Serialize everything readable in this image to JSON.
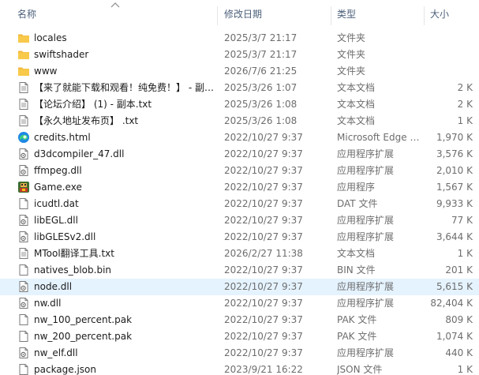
{
  "header": {
    "name": "名称",
    "date": "修改日期",
    "type": "类型",
    "size": "大小"
  },
  "rows": [
    {
      "name": "locales",
      "date": "2025/3/7 21:17",
      "type": "文件夹",
      "size": "",
      "icon": "folder-icon"
    },
    {
      "name": "swiftshader",
      "date": "2025/3/7 21:17",
      "type": "文件夹",
      "size": "",
      "icon": "folder-icon"
    },
    {
      "name": "www",
      "date": "2026/7/6 21:25",
      "type": "文件夹",
      "size": "",
      "icon": "folder-icon"
    },
    {
      "name": "【来了就能下载和观看！纯免费！】 - 副…",
      "date": "2025/3/26 1:07",
      "type": "文本文档",
      "size": "2 K",
      "icon": "text-file-icon"
    },
    {
      "name": "【论坛介绍】 (1) - 副本.txt",
      "date": "2025/3/26 1:08",
      "type": "文本文档",
      "size": "2 K",
      "icon": "text-file-icon"
    },
    {
      "name": "【永久地址发布页】 .txt",
      "date": "2025/3/26 1:08",
      "type": "文本文档",
      "size": "1 K",
      "icon": "text-file-icon"
    },
    {
      "name": "credits.html",
      "date": "2022/10/27 9:37",
      "type": "Microsoft Edge …",
      "size": "1,970 K",
      "icon": "edge-icon"
    },
    {
      "name": "d3dcompiler_47.dll",
      "date": "2022/10/27 9:37",
      "type": "应用程序扩展",
      "size": "3,576 K",
      "icon": "dll-file-icon"
    },
    {
      "name": "ffmpeg.dll",
      "date": "2022/10/27 9:37",
      "type": "应用程序扩展",
      "size": "2,010 K",
      "icon": "dll-file-icon"
    },
    {
      "name": "Game.exe",
      "date": "2022/10/27 9:37",
      "type": "应用程序",
      "size": "1,567 K",
      "icon": "game-exe-icon"
    },
    {
      "name": "icudtl.dat",
      "date": "2022/10/27 9:37",
      "type": "DAT 文件",
      "size": "9,933 K",
      "icon": "file-icon"
    },
    {
      "name": "libEGL.dll",
      "date": "2022/10/27 9:37",
      "type": "应用程序扩展",
      "size": "77 K",
      "icon": "dll-file-icon"
    },
    {
      "name": "libGLESv2.dll",
      "date": "2022/10/27 9:37",
      "type": "应用程序扩展",
      "size": "3,644 K",
      "icon": "dll-file-icon"
    },
    {
      "name": "MTool翻译工具.txt",
      "date": "2026/2/27 11:38",
      "type": "文本文档",
      "size": "1 K",
      "icon": "text-file-icon"
    },
    {
      "name": "natives_blob.bin",
      "date": "2022/10/27 9:37",
      "type": "BIN 文件",
      "size": "201 K",
      "icon": "file-icon"
    },
    {
      "name": "node.dll",
      "date": "2022/10/27 9:37",
      "type": "应用程序扩展",
      "size": "5,615 K",
      "icon": "dll-file-icon",
      "selected": true
    },
    {
      "name": "nw.dll",
      "date": "2022/10/27 9:37",
      "type": "应用程序扩展",
      "size": "82,404 K",
      "icon": "dll-file-icon"
    },
    {
      "name": "nw_100_percent.pak",
      "date": "2022/10/27 9:37",
      "type": "PAK 文件",
      "size": "809 K",
      "icon": "file-icon"
    },
    {
      "name": "nw_200_percent.pak",
      "date": "2022/10/27 9:37",
      "type": "PAK 文件",
      "size": "1,074 K",
      "icon": "file-icon"
    },
    {
      "name": "nw_elf.dll",
      "date": "2022/10/27 9:37",
      "type": "应用程序扩展",
      "size": "440 K",
      "icon": "dll-file-icon"
    },
    {
      "name": "package.json",
      "date": "2023/9/21 16:22",
      "type": "JSON 文件",
      "size": "1 K",
      "icon": "file-icon"
    }
  ],
  "colors": {
    "header_text": "#4c607a",
    "secondary_text": "#6d6d6d",
    "selected_row": "#e5f3ff",
    "folder": "#f8c94a"
  }
}
